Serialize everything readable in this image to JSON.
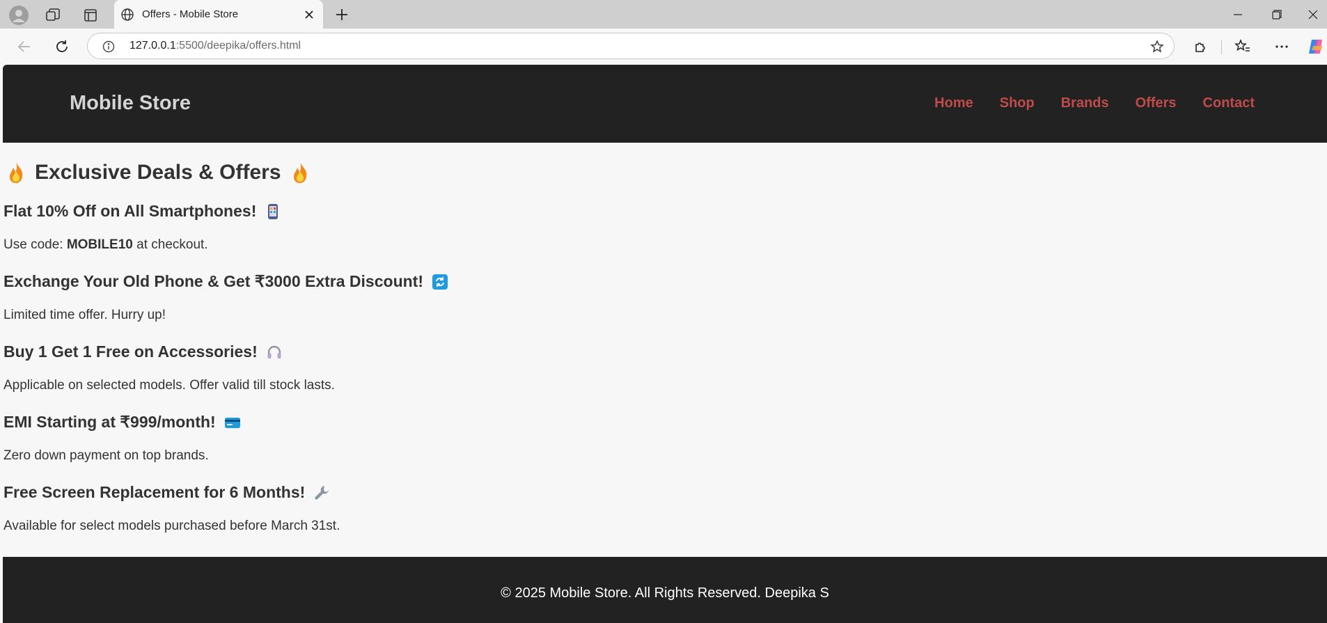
{
  "browser": {
    "tab_title": "Offers - Mobile Store",
    "url_host": "127.0.0.1",
    "url_path": ":5500/deepika/offers.html"
  },
  "site": {
    "brand": "Mobile Store",
    "nav": [
      "Home",
      "Shop",
      "Brands",
      "Offers",
      "Contact"
    ],
    "accent_color": "#c04b4b",
    "header_bg": "#222222"
  },
  "page": {
    "title": "Exclusive Deals & Offers",
    "offers": [
      {
        "heading": "Flat 10% Off on All Smartphones!",
        "icon": "mobile-phone-icon",
        "desc_prefix": "Use code: ",
        "desc_code": "MOBILE10",
        "desc_suffix": " at checkout."
      },
      {
        "heading": "Exchange Your Old Phone & Get ₹3000 Extra Discount!",
        "icon": "arrows-cycle-icon",
        "desc": "Limited time offer. Hurry up!"
      },
      {
        "heading": "Buy 1 Get 1 Free on Accessories!",
        "icon": "headphones-icon",
        "desc": "Applicable on selected models. Offer valid till stock lasts."
      },
      {
        "heading": "EMI Starting at ₹999/month!",
        "icon": "credit-card-icon",
        "desc": "Zero down payment on top brands."
      },
      {
        "heading": "Free Screen Replacement for 6 Months!",
        "icon": "wrench-icon",
        "desc": "Available for select models purchased before March 31st."
      }
    ]
  },
  "footer": {
    "text": "© 2025 Mobile Store. All Rights Reserved. Deepika S"
  }
}
